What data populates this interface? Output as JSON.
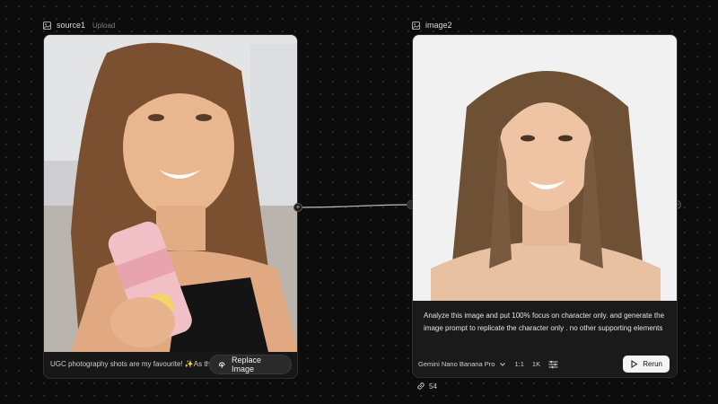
{
  "nodes": {
    "source": {
      "title": "source1",
      "subtitle": "Upload",
      "caption": "UGC photography shots are my favourite! ✨As th...",
      "replace_label": "Replace Image"
    },
    "image2": {
      "title": "image2",
      "prompt": "Analyze this image and put 100% focus on character only. and generate the image prompt to replicate the character only . no other supporting elements",
      "model": "Gemini Nano Banana Pro",
      "aspect_ratio": "1:1",
      "resolution": "1K",
      "rerun_label": "Rerun",
      "link_count": "54"
    }
  },
  "icons": {
    "node": "image-icon",
    "replace": "replace-image-icon",
    "model": "chevron-down-icon",
    "settings": "sliders-icon",
    "rerun": "play-icon",
    "link": "link-icon"
  },
  "colors": {
    "canvas": "#0c0c0c",
    "node_bg": "#171717",
    "rerun_bg": "#f4f4f4"
  }
}
